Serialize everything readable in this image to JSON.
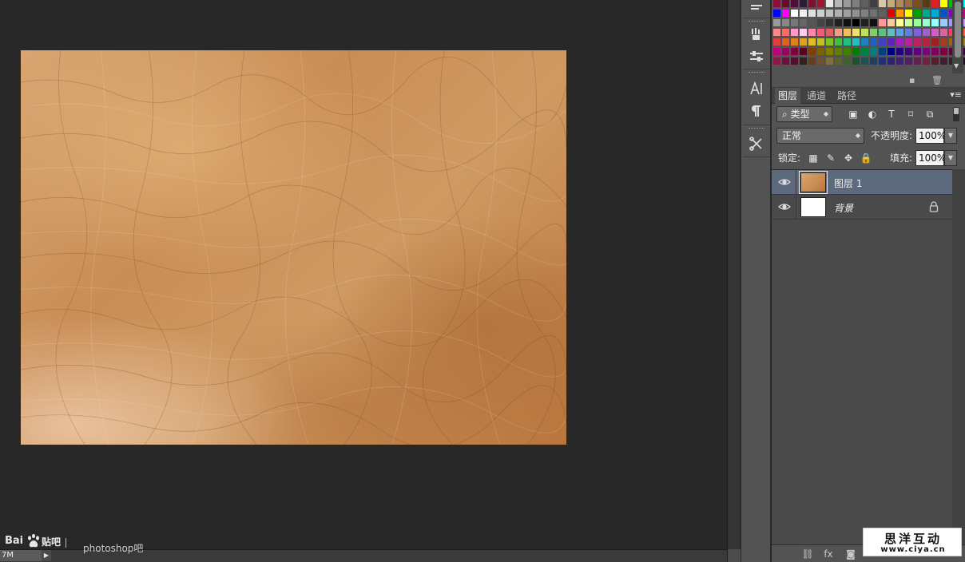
{
  "status": {
    "zoom_text": "7M",
    "arrow": "▶"
  },
  "watermark": {
    "bai": "Bai",
    "tieba": "贴吧",
    "site": "photoshop吧"
  },
  "layers_panel": {
    "tabs": [
      "图层",
      "通道",
      "路径"
    ],
    "filter_kind": "类型",
    "blend_mode": "正常",
    "opacity_label": "不透明度:",
    "opacity_value": "100%",
    "lock_label": "锁定:",
    "fill_label": "填充:",
    "fill_value": "100%",
    "layers": [
      {
        "name": "图层 1",
        "selected": true,
        "locked": false
      },
      {
        "name": "背景",
        "selected": false,
        "locked": true
      }
    ]
  },
  "badge": {
    "title": "思洋互动",
    "url": "www.ciya.cn"
  },
  "colors": {
    "selection": "#5d6a7d",
    "leather": "#c98d55",
    "panel": "#535353",
    "workspace": "#282828"
  },
  "swatches": [
    [
      "#8b0e3a",
      "#6b0a2f",
      "#4f0f3a",
      "#2e1a3a",
      "#7a1234",
      "#a01830",
      "#e8e8e8",
      "#b6b6b6",
      "#9a9a9a",
      "#7f7f7f",
      "#5f5f5f",
      "#3f3f3f",
      "#d8c8a8",
      "#c9a87a",
      "#b08a5a",
      "#9a6e3a",
      "#7a5020",
      "#5a3a10",
      "#e02020",
      "#ffff00",
      "#00c000",
      "#00ffff"
    ],
    [
      "#0000ff",
      "#ff00ff",
      "#ffffff",
      "#f0f0f0",
      "#e0e0e0",
      "#d0d0d0",
      "#c0c0c0",
      "#b0b0b0",
      "#a0a0a0",
      "#909090",
      "#808080",
      "#707070",
      "#606060",
      "#e00000",
      "#ff9900",
      "#ffff00",
      "#00a000",
      "#00aa88",
      "#00aadd",
      "#0055cc",
      "#8800cc",
      "#cc0088"
    ],
    [
      "#9a9a9a",
      "#888888",
      "#777777",
      "#666666",
      "#555555",
      "#444444",
      "#333333",
      "#222222",
      "#111111",
      "#000000",
      "#202020",
      "#101010",
      "#ff9999",
      "#ffcc99",
      "#ffff99",
      "#ccff99",
      "#99ff99",
      "#99ffcc",
      "#99ffff",
      "#99ccff",
      "#9999ff",
      "#cc99ff"
    ],
    [
      "#ff8888",
      "#ff6666",
      "#ff99cc",
      "#ffccee",
      "#ff88aa",
      "#ff5577",
      "#e06060",
      "#f0a080",
      "#f0c060",
      "#f0e060",
      "#c0e060",
      "#80d060",
      "#60c080",
      "#60c0c0",
      "#60a0e0",
      "#6080e0",
      "#8060e0",
      "#a060d0",
      "#d060c0",
      "#e060a0",
      "#ff4060",
      "#ff6040"
    ],
    [
      "#e04040",
      "#e06020",
      "#e08020",
      "#e0a020",
      "#e0c020",
      "#c0c020",
      "#80c020",
      "#40c040",
      "#20c080",
      "#20c0c0",
      "#2080c0",
      "#2060c0",
      "#4040c0",
      "#6020c0",
      "#a020c0",
      "#c020a0",
      "#c02060",
      "#c02040",
      "#a02020",
      "#a04020",
      "#a06020",
      "#a08020"
    ],
    [
      "#c0007a",
      "#a00060",
      "#800040",
      "#600020",
      "#804000",
      "#806000",
      "#808000",
      "#608000",
      "#408000",
      "#008000",
      "#008040",
      "#008080",
      "#004080",
      "#000080",
      "#200080",
      "#400080",
      "#600080",
      "#800080",
      "#800060",
      "#800040",
      "#600040",
      "#400040"
    ],
    [
      "#8a1a4a",
      "#6a1040",
      "#501030",
      "#302020",
      "#604020",
      "#705030",
      "#807040",
      "#606030",
      "#406030",
      "#205030",
      "#205050",
      "#204060",
      "#203070",
      "#302070",
      "#402070",
      "#502060",
      "#602050",
      "#702040",
      "#502030",
      "#402030",
      "#302030",
      "#201020"
    ]
  ]
}
